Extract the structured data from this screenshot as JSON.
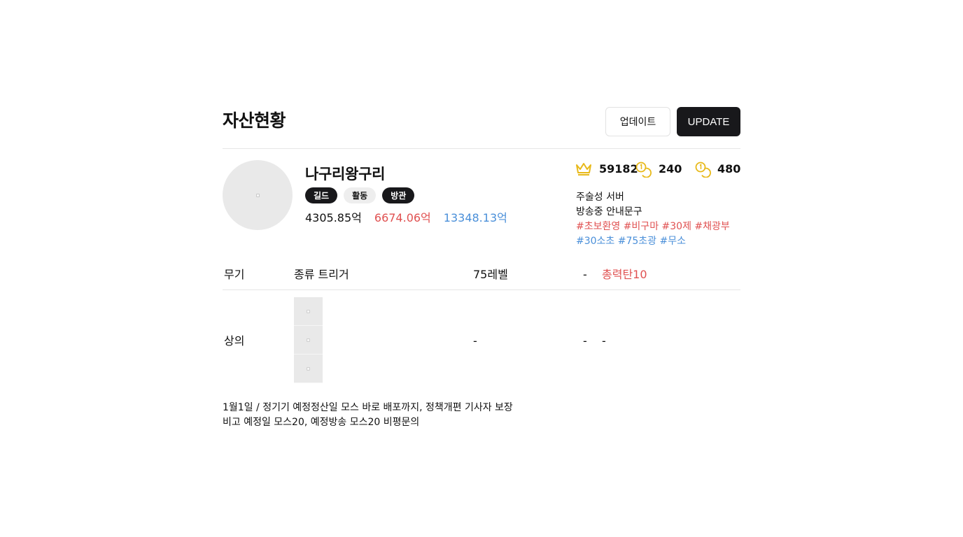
{
  "header": {
    "title": "자산현황",
    "update_ko_label": "업데이트",
    "update_en_label": "UPDATE"
  },
  "profile": {
    "nickname": "나구리왕구리",
    "tags": [
      "길드",
      "활동",
      "방관"
    ],
    "amounts": {
      "black": "4305.85억",
      "red": "6674.06억",
      "blue": "13348.13억"
    }
  },
  "stats": [
    {
      "icon": "crown-icon",
      "value": "59182"
    },
    {
      "icon": "coin-icon",
      "value": "240"
    },
    {
      "icon": "coin-icon",
      "value": "480"
    }
  ],
  "server": {
    "name": "주술성 서버",
    "broadcast_notice": "방송중 안내문구",
    "hashtags_red": "#초보환영 #비구마 #30제 #채광부",
    "hashtags_blue": "#30소초 #75초광 #무소"
  },
  "equipment": {
    "weapon": {
      "slot": "무기",
      "name": "종류 트리거",
      "level": "75레벨",
      "dash": "-",
      "option": "총력탄10"
    },
    "top": {
      "slot": "상의",
      "level": "-",
      "dash": "-",
      "option": "-"
    }
  },
  "notice": {
    "line1": "1월1일 / 정기기 예정정산일 모스 바로 배포까지, 정책개편 기사자 보장",
    "line2": "비고 예정일 모스20, 예정방송 모스20 비평문의"
  },
  "colors": {
    "accent_dark": "#18181b",
    "red": "#e05151",
    "blue": "#4a8fd9",
    "gold": "#e8b91a"
  }
}
